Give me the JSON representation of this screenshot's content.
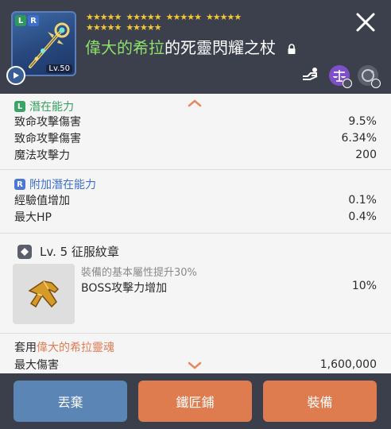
{
  "header": {
    "item": {
      "tag_l": "L",
      "tag_r": "R",
      "level_badge": "Lv.50"
    },
    "stars_row1": [
      "★★★★★",
      "★★★★★",
      "★★★★★",
      "★★★★★"
    ],
    "stars_row2": [
      "★★★★★",
      "★★★★★"
    ],
    "title_highlight": "偉大的希拉",
    "title_rest": "的死靈閃耀之杖",
    "icons": [
      "lock-icon",
      "trade-icon",
      "scale-icon",
      "cycle-icon",
      "close-icon",
      "play-icon"
    ],
    "colors": {
      "highlight": "#8de06d",
      "stars": "#f3c733"
    }
  },
  "potential": {
    "badge": "L",
    "title": "潛在能力",
    "rows": [
      {
        "label": "致命攻擊傷害",
        "value": "9.5%"
      },
      {
        "label": "致命攻擊傷害",
        "value": "6.34%"
      },
      {
        "label": "魔法攻擊力",
        "value": "200"
      }
    ]
  },
  "additional": {
    "badge": "R",
    "title": "附加潛在能力",
    "rows": [
      {
        "label": "經驗值增加",
        "value": "0.1%"
      },
      {
        "label": "最大HP",
        "value": "0.4%"
      }
    ]
  },
  "emblem": {
    "title": "Lv. 5 征服紋章",
    "desc": "裝備的基本屬性提升30%",
    "stat_label": "BOSS攻擊力增加",
    "stat_value": "10%"
  },
  "set": {
    "prefix": "套用",
    "name": "偉大的希拉靈魂",
    "stat_label": "最大傷害",
    "stat_value": "1,600,000"
  },
  "buttons": {
    "discard": "丟棄",
    "blacksmith": "鐵匠鋪",
    "equip": "裝備"
  }
}
